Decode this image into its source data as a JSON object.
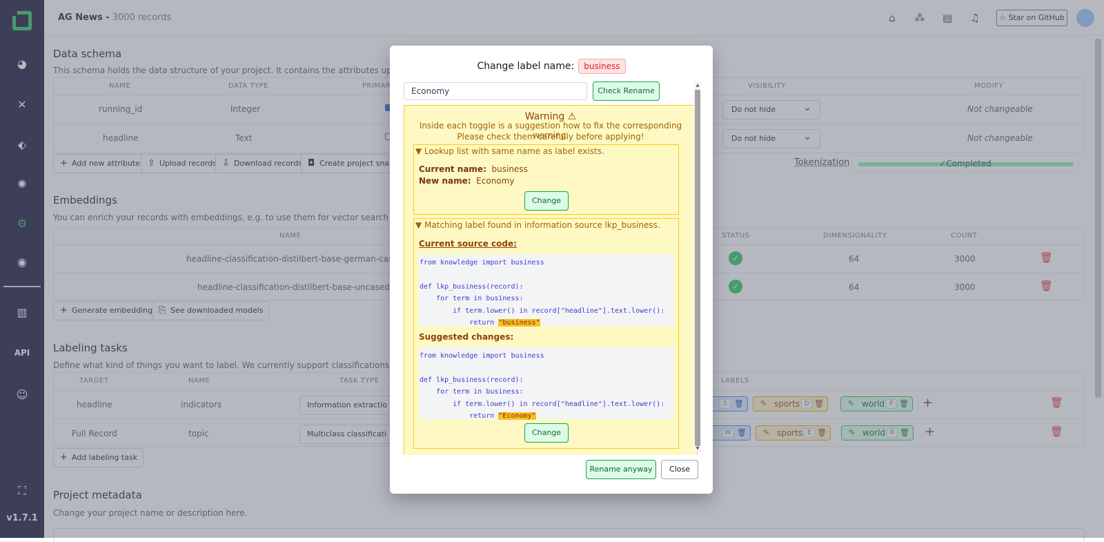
{
  "app": {
    "version": "v1.7.1"
  },
  "header": {
    "project_name": "AG News -",
    "record_count": "3000 records",
    "github_label": "Star on GitHub"
  },
  "schema": {
    "title": "Data schema",
    "description": "This schema holds the data structure of your project. It contains the attributes uploaded o",
    "columns": {
      "name": "NAME",
      "data_type": "DATA TYPE",
      "primary": "PRIMARY",
      "visibility": "VISIBILITY",
      "modify": "MODIFY"
    },
    "rows": [
      {
        "name": "running_id",
        "data_type": "Integer",
        "primary": true,
        "visibility": "Do not hide",
        "modify": "Not changeable"
      },
      {
        "name": "headline",
        "data_type": "Text",
        "primary": false,
        "visibility": "Do not hide",
        "modify": "Not changeable"
      }
    ],
    "buttons": {
      "add_attribute": "Add new attribute",
      "upload": "Upload records",
      "download": "Download records",
      "snapshot": "Create project snapsh"
    },
    "tokenization_label": "Tokenization",
    "tokenization_status": "✓Completed"
  },
  "embeddings": {
    "title": "Embeddings",
    "description": "You can enrich your records with embeddings, e.g. to use them for vector search or active l",
    "columns": {
      "name": "NAME",
      "status": "STATUS",
      "dimensionality": "DIMENSIONALITY",
      "count": "COUNT"
    },
    "rows": [
      {
        "name": "headline-classification-distilbert-base-german-cased",
        "dimensionality": "64",
        "count": "3000"
      },
      {
        "name": "headline-classification-distilbert-base-uncased",
        "dimensionality": "64",
        "count": "3000"
      }
    ],
    "buttons": {
      "generate": "Generate embedding",
      "models": "See downloaded models"
    }
  },
  "labeling": {
    "title": "Labeling tasks",
    "description": "Define what kind of things you want to label. We currently support classifications and extra",
    "columns": {
      "target": "TARGET",
      "name": "NAME",
      "task_type": "TASK TYPE",
      "labels": "LABELS"
    },
    "rows": [
      {
        "target": "headline",
        "name": "indicators",
        "task_type": "Information extractio",
        "key_blue": "S",
        "label_orange": "sports",
        "key_orange": "D",
        "label_green": "world",
        "key_green": "F"
      },
      {
        "target": "Full Record",
        "name": "topic",
        "task_type": "Multiclass classificati",
        "key_blue": "W",
        "label_orange": "sports",
        "key_orange": "E",
        "label_green": "world",
        "key_green": "R"
      }
    ],
    "add_task": "Add labeling task"
  },
  "metadata": {
    "title": "Project metadata",
    "description": "Change your project name or description here."
  },
  "modal": {
    "title": "Change label name:",
    "old_label": "business",
    "input_value": "Economy",
    "check_button": "Check Rename",
    "warning_title": "Warning ⚠",
    "warning_line1": "Inside each toggle is a suggestion how to fix the corresponding warning.",
    "warning_line2": "Please check them carefully before applying!",
    "toggle1": {
      "header": "Lookup list with same name as label exists.",
      "current_label": "Current name:",
      "current_value": "business",
      "new_label": "New name:",
      "new_value": "Economy",
      "button": "Change"
    },
    "toggle2": {
      "header": "Matching label found in information source lkp_business.",
      "current_code_title": "Current source code:",
      "current_code_body": "from knowledge import business\n\ndef lkp_business(record):\n    for term in business:\n        if term.lower() in record[\"headline\"].text.lower():\n            return ",
      "current_code_highlight": "\"business\"",
      "suggested_title": "Suggested changes:",
      "suggested_code_body": "from knowledge import business\n\ndef lkp_business(record):\n    for term in business:\n        if term.lower() in record[\"headline\"].text.lower():\n            return ",
      "suggested_code_highlight": "\"Economy\"",
      "button": "Change"
    },
    "rename_anyway": "Rename anyway",
    "close": "Close"
  }
}
